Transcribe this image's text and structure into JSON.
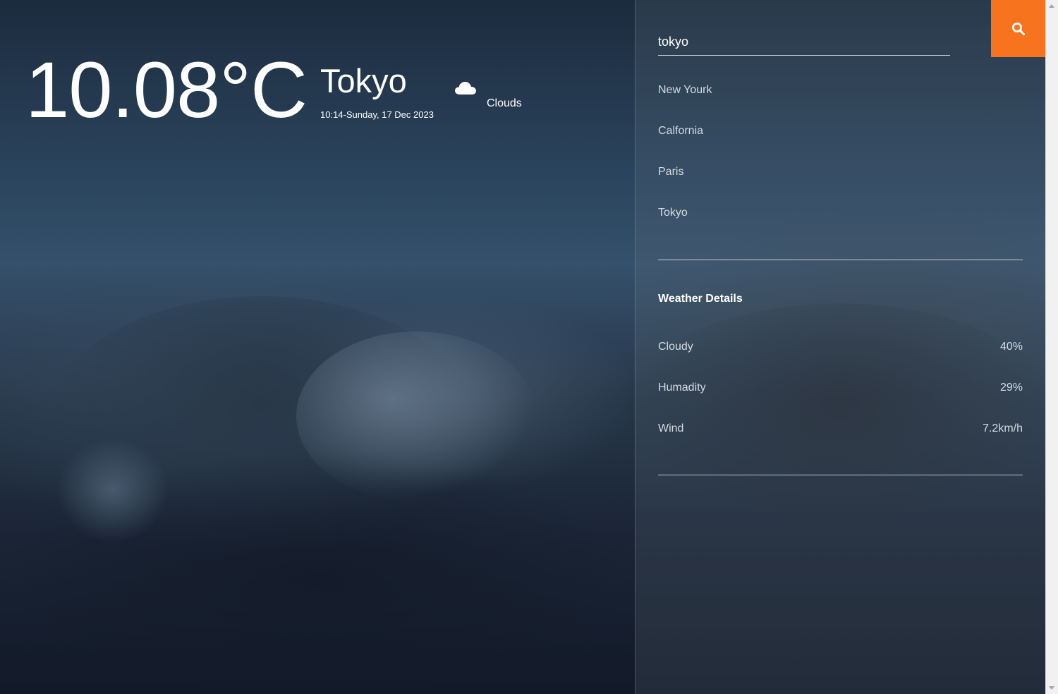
{
  "weather": {
    "temperature": "10.08°C",
    "city": "Tokyo",
    "datetime": "10:14-Sunday, 17 Dec 2023",
    "condition": "Clouds",
    "condition_icon": "cloud-icon"
  },
  "search": {
    "value": "tokyo",
    "button_icon": "search-icon",
    "button_color": "#f8731e"
  },
  "cities": [
    {
      "label": "New Yourk"
    },
    {
      "label": "Calfornia"
    },
    {
      "label": "Paris"
    },
    {
      "label": "Tokyo"
    }
  ],
  "details": {
    "title": "Weather Details",
    "rows": [
      {
        "label": "Cloudy",
        "value": "40%"
      },
      {
        "label": "Humadity",
        "value": "29%"
      },
      {
        "label": "Wind",
        "value": "7.2km/h"
      }
    ]
  }
}
